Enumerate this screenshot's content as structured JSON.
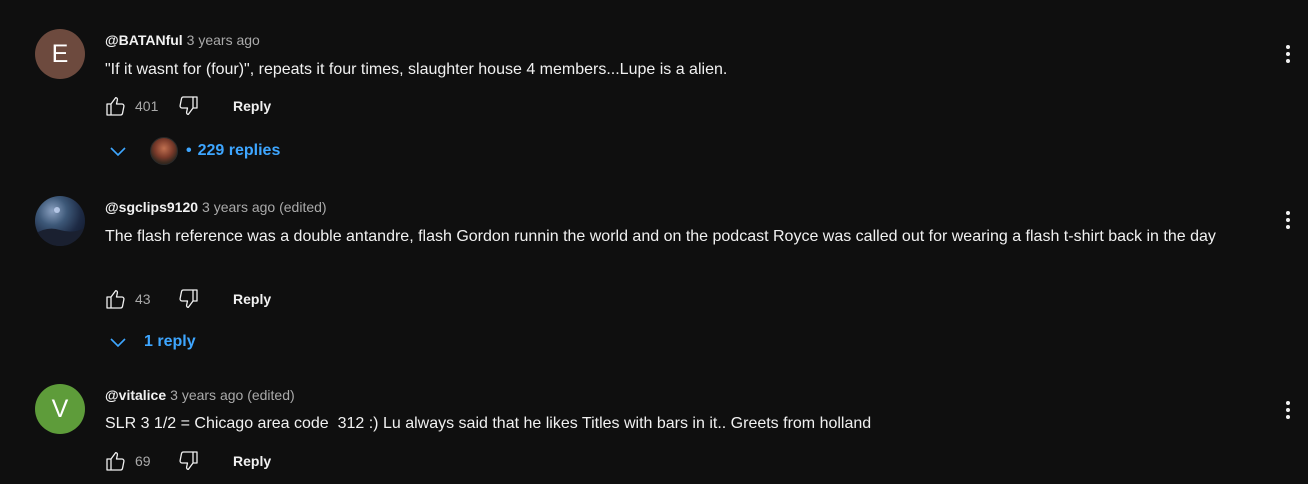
{
  "comments": [
    {
      "avatar_letter": "E",
      "author": "@BATANful",
      "meta": "3 years ago",
      "text": "\"If it wasnt for (four)\", repeats it four times, slaughter house 4 members...Lupe is a alien.",
      "likes": "401",
      "reply_label": "Reply",
      "replies_label": "229 replies"
    },
    {
      "avatar_letter": "",
      "author": "@sgclips9120",
      "meta": "3 years ago (edited)",
      "text": "The flash reference was a double antandre, flash Gordon runnin the world and on the podcast Royce was called out for wearing a flash t-shirt back in the day",
      "likes": "43",
      "reply_label": "Reply",
      "replies_label": "1 reply"
    },
    {
      "avatar_letter": "V",
      "author": "@vitalice",
      "meta": "3 years ago (edited)",
      "text": "SLR 3 1/2 = Chicago area code  312 :) Lu always said that he likes Titles with bars in it.. Greets from holland",
      "likes": "69",
      "reply_label": "Reply"
    }
  ],
  "colors": {
    "background": "#0f0f0f",
    "link": "#3ea6ff",
    "secondary_text": "#aaaaaa",
    "avatar_e": "#6d4a3e",
    "avatar_v": "#5e9c3a"
  },
  "icons": [
    "thumbs-up-icon",
    "thumbs-down-icon",
    "more-vert-icon",
    "chevron-down-icon"
  ]
}
